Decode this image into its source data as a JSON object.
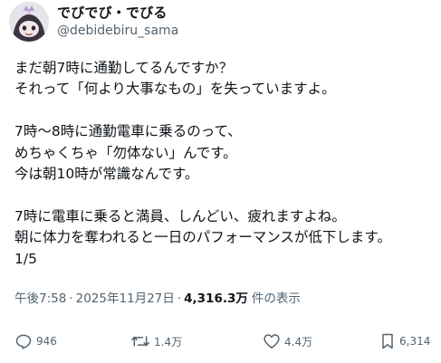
{
  "author": {
    "display_name": "でびでび・でびる",
    "handle": "@debidebiru_sama"
  },
  "body_lines": [
    "まだ朝7時に通勤してるんですか？",
    "それって「何より大事なもの」を失っていますよ。",
    "",
    "7時〜8時に通勤電車に乗るのって、",
    "めちゃくちゃ「勿体ない」んです。",
    "今は朝10時が常識なんです。",
    "",
    "7時に電車に乗ると満員、しんどい、疲れますよね。",
    "朝に体力を奪われると一日のパフォーマンスが低下します。",
    "1/5"
  ],
  "meta": {
    "time": "午後7:58",
    "separator": "·",
    "date": "2025年11月27日",
    "views_count": "4,316.3万",
    "views_label": "件の表示"
  },
  "actions": {
    "reply": {
      "icon": "reply-icon",
      "count": "946"
    },
    "repost": {
      "icon": "repost-icon",
      "count": "1.4万"
    },
    "like": {
      "icon": "heart-icon",
      "count": "4.4万"
    },
    "bookmark": {
      "icon": "bookmark-icon",
      "count": "6,314"
    }
  },
  "colors": {
    "text_primary": "#0f1419",
    "text_secondary": "#536471",
    "background": "#ffffff"
  }
}
